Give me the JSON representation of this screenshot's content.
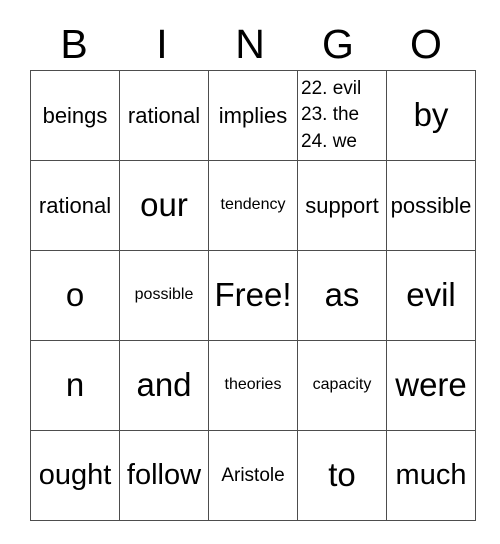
{
  "card": {
    "header_letters": [
      "B",
      "I",
      "N",
      "G",
      "O"
    ],
    "rows": [
      [
        {
          "text": "beings",
          "size": "md"
        },
        {
          "text": "rational",
          "size": "md"
        },
        {
          "text": "implies",
          "size": "md"
        },
        {
          "lines": [
            "22. evil",
            "23. the",
            "24. we"
          ],
          "size": "sm"
        },
        {
          "text": "by",
          "size": "xl"
        }
      ],
      [
        {
          "text": "rational",
          "size": "md"
        },
        {
          "text": "our",
          "size": "xl"
        },
        {
          "text": "tendency",
          "size": "xs"
        },
        {
          "text": "support",
          "size": "md"
        },
        {
          "text": "possible",
          "size": "md"
        }
      ],
      [
        {
          "text": "o",
          "size": "xl"
        },
        {
          "text": "possible",
          "size": "xs"
        },
        {
          "text": "Free!",
          "size": "xl"
        },
        {
          "text": "as",
          "size": "xl"
        },
        {
          "text": "evil",
          "size": "xl"
        }
      ],
      [
        {
          "text": "n",
          "size": "xl"
        },
        {
          "text": "and",
          "size": "xl"
        },
        {
          "text": "theories",
          "size": "xs"
        },
        {
          "text": "capacity",
          "size": "xs"
        },
        {
          "text": "were",
          "size": "xl"
        }
      ],
      [
        {
          "text": "ought",
          "size": "lg"
        },
        {
          "text": "follow",
          "size": "lg"
        },
        {
          "text": "Aristole",
          "size": "sm"
        },
        {
          "text": "to",
          "size": "xl"
        },
        {
          "text": "much",
          "size": "lg"
        }
      ]
    ],
    "free_space": {
      "row": 2,
      "col": 2,
      "label": "Free!"
    },
    "colors": {
      "background": "#ffffff",
      "text": "#000000",
      "grid_line": "#4d4d4d"
    }
  }
}
